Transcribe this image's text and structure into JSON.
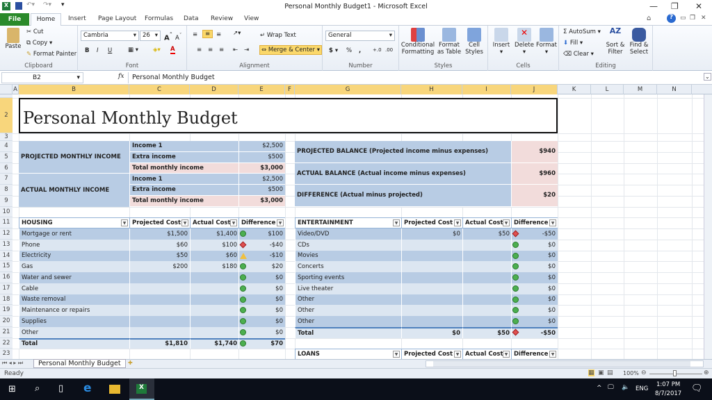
{
  "window": {
    "title": "Personal Monthly Budget1  -  Microsoft Excel"
  },
  "tabs": [
    "File",
    "Home",
    "Insert",
    "Page Layout",
    "Formulas",
    "Data",
    "Review",
    "View"
  ],
  "ribbon": {
    "clipboard": {
      "label": "Clipboard",
      "paste": "Paste",
      "cut": "Cut",
      "copy": "Copy",
      "format_painter": "Format Painter"
    },
    "font": {
      "label": "Font",
      "name": "Cambria",
      "size": "26",
      "bold": "B",
      "italic": "I",
      "underline": "U"
    },
    "alignment": {
      "label": "Alignment",
      "wrap": "Wrap Text",
      "merge": "Merge & Center"
    },
    "number": {
      "label": "Number",
      "format": "General",
      "currency": "$",
      "percent": "%",
      "comma": ",",
      "inc": "+.0",
      "dec": ".00"
    },
    "styles": {
      "label": "Styles",
      "cond": "Conditional Formatting",
      "table": "Format as Table",
      "cell": "Cell Styles"
    },
    "cells": {
      "label": "Cells",
      "insert": "Insert",
      "delete": "Delete",
      "format": "Format"
    },
    "editing": {
      "label": "Editing",
      "autosum": "AutoSum",
      "fill": "Fill",
      "clear": "Clear",
      "sort": "Sort & Filter",
      "find": "Find & Select"
    }
  },
  "formula_bar": {
    "name_box": "B2",
    "fx": "fx",
    "value": "Personal Monthly Budget"
  },
  "columns": [
    "A",
    "B",
    "C",
    "D",
    "E",
    "F",
    "G",
    "H",
    "I",
    "J",
    "K",
    "L",
    "M",
    "N"
  ],
  "selected_columns": [
    "B",
    "C",
    "D",
    "E",
    "F",
    "G",
    "H",
    "I",
    "J"
  ],
  "sheet": {
    "title": "Personal Monthly Budget",
    "income": {
      "projected_label": "PROJECTED MONTHLY INCOME",
      "actual_label": "ACTUAL MONTHLY INCOME",
      "projected": [
        {
          "label": "Income 1",
          "value": "$2,500"
        },
        {
          "label": "Extra income",
          "value": "$500"
        },
        {
          "label": "Total monthly income",
          "value": "$3,000"
        }
      ],
      "actual": [
        {
          "label": "Income 1",
          "value": "$2,500"
        },
        {
          "label": "Extra income",
          "value": "$500"
        },
        {
          "label": "Total monthly income",
          "value": "$3,000"
        }
      ]
    },
    "balance": [
      {
        "label": "PROJECTED BALANCE (Projected income minus expenses)",
        "value": "$940"
      },
      {
        "label": "ACTUAL BALANCE (Actual income minus expenses)",
        "value": "$960"
      },
      {
        "label": "DIFFERENCE (Actual minus projected)",
        "value": "$20"
      }
    ],
    "housing": {
      "headers": [
        "HOUSING",
        "Projected Cost",
        "Actual Cost",
        "Difference"
      ],
      "rows": [
        {
          "item": "Mortgage or rent",
          "projected": "$1,500",
          "actual": "$1,400",
          "indicator": "green",
          "diff": "$100"
        },
        {
          "item": "Phone",
          "projected": "$60",
          "actual": "$100",
          "indicator": "red",
          "diff": "-$40"
        },
        {
          "item": "Electricity",
          "projected": "$50",
          "actual": "$60",
          "indicator": "yellow",
          "diff": "-$10"
        },
        {
          "item": "Gas",
          "projected": "$200",
          "actual": "$180",
          "indicator": "green",
          "diff": "$20"
        },
        {
          "item": "Water and sewer",
          "projected": "",
          "actual": "",
          "indicator": "green",
          "diff": "$0"
        },
        {
          "item": "Cable",
          "projected": "",
          "actual": "",
          "indicator": "green",
          "diff": "$0"
        },
        {
          "item": "Waste removal",
          "projected": "",
          "actual": "",
          "indicator": "green",
          "diff": "$0"
        },
        {
          "item": "Maintenance or repairs",
          "projected": "",
          "actual": "",
          "indicator": "green",
          "diff": "$0"
        },
        {
          "item": "Supplies",
          "projected": "",
          "actual": "",
          "indicator": "green",
          "diff": "$0"
        },
        {
          "item": "Other",
          "projected": "",
          "actual": "",
          "indicator": "green",
          "diff": "$0"
        }
      ],
      "total": {
        "item": "Total",
        "projected": "$1,810",
        "actual": "$1,740",
        "indicator": "green",
        "diff": "$70"
      }
    },
    "entertainment": {
      "headers": [
        "ENTERTAINMENT",
        "Projected Cost",
        "Actual Cost",
        "Difference"
      ],
      "rows": [
        {
          "item": "Video/DVD",
          "projected": "$0",
          "actual": "$50",
          "indicator": "red",
          "diff": "-$50"
        },
        {
          "item": "CDs",
          "projected": "",
          "actual": "",
          "indicator": "green",
          "diff": "$0"
        },
        {
          "item": "Movies",
          "projected": "",
          "actual": "",
          "indicator": "green",
          "diff": "$0"
        },
        {
          "item": "Concerts",
          "projected": "",
          "actual": "",
          "indicator": "green",
          "diff": "$0"
        },
        {
          "item": "Sporting events",
          "projected": "",
          "actual": "",
          "indicator": "green",
          "diff": "$0"
        },
        {
          "item": "Live theater",
          "projected": "",
          "actual": "",
          "indicator": "green",
          "diff": "$0"
        },
        {
          "item": "Other",
          "projected": "",
          "actual": "",
          "indicator": "green",
          "diff": "$0"
        },
        {
          "item": "Other",
          "projected": "",
          "actual": "",
          "indicator": "green",
          "diff": "$0"
        },
        {
          "item": "Other",
          "projected": "",
          "actual": "",
          "indicator": "green",
          "diff": "$0"
        }
      ],
      "total": {
        "item": "Total",
        "projected": "$0",
        "actual": "$50",
        "indicator": "red",
        "diff": "-$50"
      }
    },
    "loans": {
      "headers": [
        "LOANS",
        "Projected Cost",
        "Actual Cost",
        "Difference"
      ]
    }
  },
  "sheet_tab": "Personal Monthly Budget",
  "status": {
    "ready": "Ready",
    "zoom": "100%"
  },
  "taskbar": {
    "lang": "ENG",
    "time": "1:07 PM",
    "date": "8/7/2017"
  },
  "colors": {
    "blue": "#b8cce4",
    "light_blue": "#dce6f1",
    "pink": "#f2dcdb",
    "green": "#4caf50",
    "red": "#e05050",
    "yellow": "#f0c040",
    "file_tab": "#2a8a2a"
  }
}
